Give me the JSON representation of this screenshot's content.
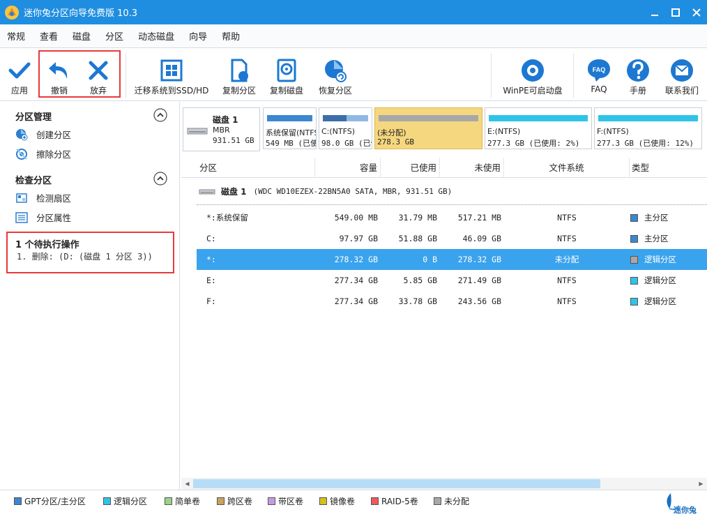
{
  "window": {
    "title": "迷你兔分区向导免费版 10.3"
  },
  "menu": [
    "常规",
    "查看",
    "磁盘",
    "分区",
    "动态磁盘",
    "向导",
    "帮助"
  ],
  "toolbar": {
    "apply": "应用",
    "undo": "撤销",
    "discard": "放弃",
    "migrate_os": "迁移系统到SSD/HD",
    "copy_partition": "复制分区",
    "copy_disk": "复制磁盘",
    "recover_partition": "恢复分区",
    "winpe": "WinPE可启动盘",
    "faq": "FAQ",
    "faq_icon_text": "FAQ",
    "manual": "手册",
    "contact": "联系我们"
  },
  "sidebar": {
    "group1_title": "分区管理",
    "create_partition": "创建分区",
    "wipe_partition": "擦除分区",
    "group2_title": "检查分区",
    "check_sector": "检测扇区",
    "partition_props": "分区属性",
    "pending_title": "1 个待执行操作",
    "pending_op": "1. 删除: (D: (磁盘 1 分区 3))"
  },
  "diskmap": {
    "disk_name": "磁盘 1",
    "disk_type": "MBR",
    "disk_size": "931.51 GB",
    "partitions": [
      {
        "label": "系统保留(NTFS)",
        "info": "549 MB (已使用",
        "bar_color": "#3b87d0",
        "used_fraction": 1.0
      },
      {
        "label": "C:(NTFS)",
        "info": "98.0 GB (已使用",
        "bar_color": "#8fb9e2",
        "used_fraction": 0.53
      },
      {
        "label": "(未分配)",
        "info": "278.3 GB",
        "bar_color": "#a8a8a8",
        "used_fraction": 1.0
      },
      {
        "label": "E:(NTFS)",
        "info": "277.3 GB (已使用: 2%)",
        "bar_color": "#2ec4e8",
        "used_fraction": 0.02
      },
      {
        "label": "F:(NTFS)",
        "info": "277.3 GB (已使用: 12%)",
        "bar_color": "#2ec4e8",
        "used_fraction": 0.12
      }
    ]
  },
  "table": {
    "headers": [
      "分区",
      "容量",
      "已使用",
      "未使用",
      "文件系统",
      "类型"
    ],
    "disk_row": {
      "name": "磁盘 1",
      "info": "(WDC WD10EZEX-22BN5A0 SATA, MBR, 931.51 GB)"
    },
    "rows": [
      {
        "partition": "*:系统保留",
        "capacity": "549.00 MB",
        "used": "31.79 MB",
        "unused": "517.21 MB",
        "fs": "NTFS",
        "type": "主分区",
        "type_color": "#3b87d0"
      },
      {
        "partition": "C:",
        "capacity": "97.97 GB",
        "used": "51.88 GB",
        "unused": "46.09 GB",
        "fs": "NTFS",
        "type": "主分区",
        "type_color": "#3b87d0"
      },
      {
        "partition": "*:",
        "capacity": "278.32 GB",
        "used": "0 B",
        "unused": "278.32 GB",
        "fs": "未分配",
        "type": "逻辑分区",
        "type_color": "#a8a8a8"
      },
      {
        "partition": "E:",
        "capacity": "277.34 GB",
        "used": "5.85 GB",
        "unused": "271.49 GB",
        "fs": "NTFS",
        "type": "逻辑分区",
        "type_color": "#2ec4e8"
      },
      {
        "partition": "F:",
        "capacity": "277.34 GB",
        "used": "33.78 GB",
        "unused": "243.56 GB",
        "fs": "NTFS",
        "type": "逻辑分区",
        "type_color": "#2ec4e8"
      }
    ]
  },
  "legend": [
    {
      "label": "GPT分区/主分区",
      "color": "#3b87d0"
    },
    {
      "label": "逻辑分区",
      "color": "#2ec4e8"
    },
    {
      "label": "简单卷",
      "color": "#9bd18b"
    },
    {
      "label": "跨区卷",
      "color": "#c9a25c"
    },
    {
      "label": "带区卷",
      "color": "#c59be0"
    },
    {
      "label": "镜像卷",
      "color": "#d4c21a"
    },
    {
      "label": "RAID-5卷",
      "color": "#ec5b5b"
    },
    {
      "label": "未分配",
      "color": "#a8a8a8"
    }
  ],
  "brand": "迷你兔"
}
